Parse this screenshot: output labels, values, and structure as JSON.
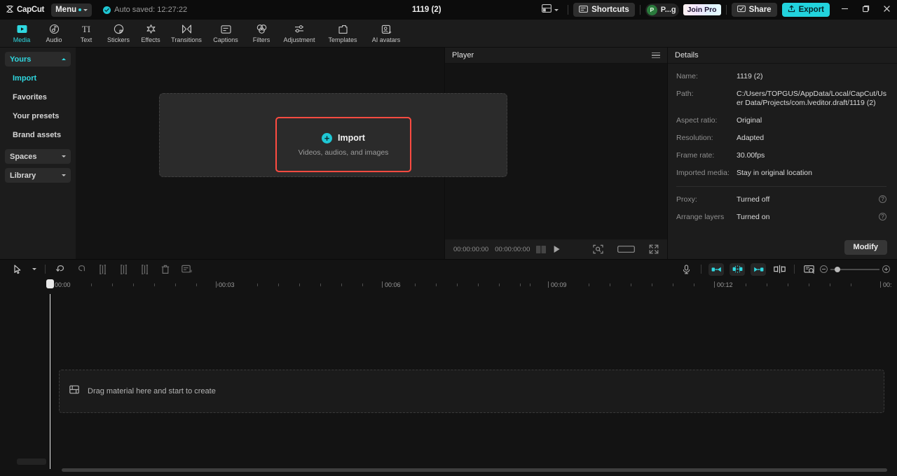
{
  "titlebar": {
    "brand": "CapCut",
    "menu_label": "Menu",
    "autosave": "Auto saved: 12:27:22",
    "doc_title": "1119 (2)",
    "shortcuts_label": "Shortcuts",
    "avatar_initial": "P",
    "avatar_name": "P...g",
    "join_pro_label": "Join Pro",
    "share_label": "Share",
    "export_label": "Export",
    "accent": "#22d3dd",
    "minimize_icon": "minimize-icon",
    "maximize_icon": "maximize-icon",
    "close_icon": "close-icon",
    "layout_icon": "layout-icon"
  },
  "tabs": [
    {
      "label": "Media",
      "icon": "media-icon",
      "active": true
    },
    {
      "label": "Audio",
      "icon": "audio-icon",
      "active": false
    },
    {
      "label": "Text",
      "icon": "text-icon",
      "active": false
    },
    {
      "label": "Stickers",
      "icon": "stickers-icon",
      "active": false
    },
    {
      "label": "Effects",
      "icon": "effects-icon",
      "active": false
    },
    {
      "label": "Transitions",
      "icon": "transitions-icon",
      "active": false
    },
    {
      "label": "Captions",
      "icon": "captions-icon",
      "active": false
    },
    {
      "label": "Filters",
      "icon": "filters-icon",
      "active": false
    },
    {
      "label": "Adjustment",
      "icon": "adjustment-icon",
      "active": false
    },
    {
      "label": "Templates",
      "icon": "templates-icon",
      "active": false
    },
    {
      "label": "AI avatars",
      "icon": "ai-avatars-icon",
      "active": false
    }
  ],
  "sidebar": [
    {
      "label": "Yours",
      "type": "group",
      "selected": true,
      "chevron": "up"
    },
    {
      "label": "Import",
      "type": "item",
      "selected": true
    },
    {
      "label": "Favorites",
      "type": "item",
      "selected": false
    },
    {
      "label": "Your presets",
      "type": "item",
      "selected": false
    },
    {
      "label": "Brand assets",
      "type": "item",
      "selected": false
    },
    {
      "label": "Spaces",
      "type": "group",
      "selected": false,
      "chevron": "down"
    },
    {
      "label": "Library",
      "type": "group",
      "selected": false,
      "chevron": "down"
    }
  ],
  "media": {
    "import_title": "Import",
    "import_subtitle": "Videos, audios, and images",
    "highlight_color": "#ff4b41"
  },
  "player": {
    "title": "Player",
    "current_time": "00:00:00:00",
    "total_time": "00:00:00:00",
    "play_icon": "play-icon",
    "snapshot_icon": "snapshot-icon",
    "ratio_icon": "ratio-icon",
    "fullscreen_icon": "fullscreen-icon",
    "menu_icon": "hamburger-icon"
  },
  "details": {
    "title": "Details",
    "rows": [
      {
        "key": "Name:",
        "value": "1119 (2)"
      },
      {
        "key": "Path:",
        "value": "C:/Users/TOPGUS/AppData/Local/CapCut/User Data/Projects/com.lveditor.draft/1119 (2)"
      },
      {
        "key": "Aspect ratio:",
        "value": "Original"
      },
      {
        "key": "Resolution:",
        "value": "Adapted"
      },
      {
        "key": "Frame rate:",
        "value": "30.00fps"
      },
      {
        "key": "Imported media:",
        "value": "Stay in original location"
      }
    ],
    "rows2": [
      {
        "key": "Proxy:",
        "value": "Turned off",
        "help": "?"
      },
      {
        "key": "Arrange layers",
        "value": "Turned on",
        "help": "?"
      }
    ],
    "modify_label": "Modify"
  },
  "timeline": {
    "tools": [
      {
        "name": "select-tool-icon"
      },
      {
        "name": "select-dropdown-icon"
      },
      {
        "name": "undo-icon"
      },
      {
        "name": "redo-icon"
      },
      {
        "name": "split-icon"
      },
      {
        "name": "trim-left-icon"
      },
      {
        "name": "trim-right-icon"
      },
      {
        "name": "delete-icon"
      },
      {
        "name": "auto-captions-icon"
      }
    ],
    "right_tools": [
      {
        "name": "microphone-icon"
      },
      {
        "name": "keyframe-prev-icon"
      },
      {
        "name": "keyframe-add-icon"
      },
      {
        "name": "keyframe-next-icon"
      },
      {
        "name": "mirror-icon"
      },
      {
        "name": "preview-scale-icon"
      }
    ],
    "ruler_labels": [
      "00:00",
      "00:03",
      "00:06",
      "00:09",
      "00:12",
      "00:"
    ],
    "drop_text": "Drag material here and start to create",
    "drop_icon": "track-icon"
  }
}
